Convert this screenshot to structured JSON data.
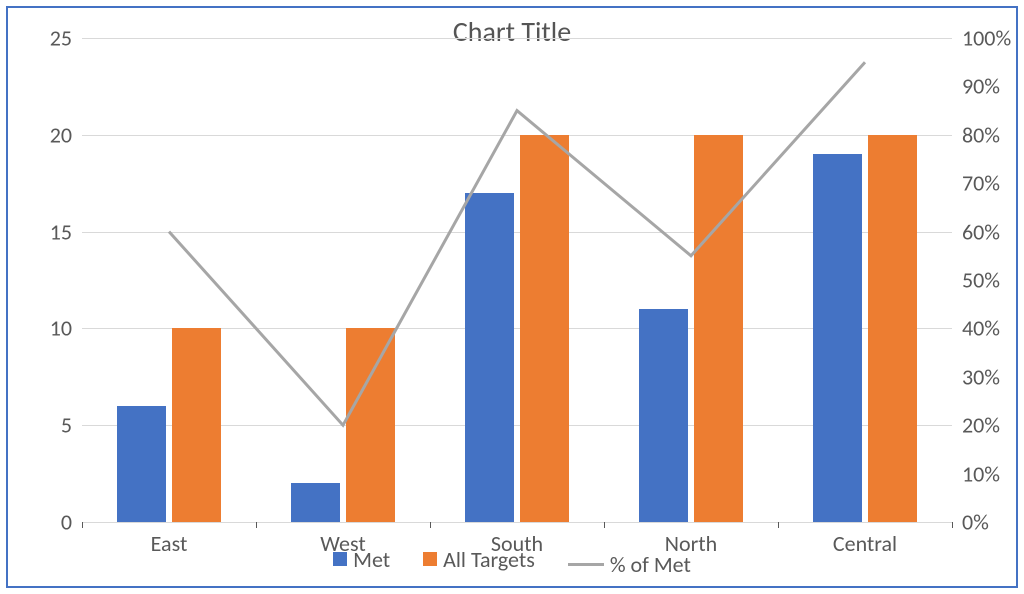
{
  "chart_data": {
    "type": "bar",
    "title": "Chart Title",
    "categories": [
      "East",
      "West",
      "South",
      "North",
      "Central"
    ],
    "y_left": {
      "min": 0,
      "max": 25,
      "step": 5,
      "labels": [
        "0",
        "5",
        "10",
        "15",
        "20",
        "25"
      ]
    },
    "y_right": {
      "min": 0,
      "max": 100,
      "step": 10,
      "labels": [
        "0%",
        "10%",
        "20%",
        "30%",
        "40%",
        "50%",
        "60%",
        "70%",
        "80%",
        "90%",
        "100%"
      ]
    },
    "series": [
      {
        "name": "Met",
        "axis": "left",
        "type": "bar",
        "color": "#4472c4",
        "values": [
          6,
          2,
          17,
          11,
          19
        ]
      },
      {
        "name": "All Targets",
        "axis": "left",
        "type": "bar",
        "color": "#ed7d31",
        "values": [
          10,
          10,
          20,
          20,
          20
        ]
      },
      {
        "name": "% of Met",
        "axis": "right",
        "type": "line",
        "color": "#a6a6a6",
        "values": [
          60,
          20,
          85,
          55,
          95
        ]
      }
    ],
    "legend_position": "bottom"
  },
  "legend": {
    "met": "Met",
    "alltargets": "All Targets",
    "pctmet": "% of Met"
  }
}
